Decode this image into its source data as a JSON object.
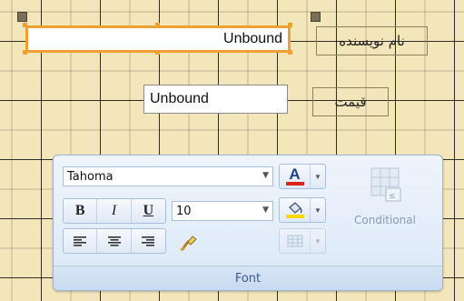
{
  "form": {
    "textbox_author": "Unbound",
    "label_author": "نام نویسنده",
    "textbox_price": "Unbound",
    "label_price": "قیمت"
  },
  "ribbon": {
    "font_name": "Tahoma",
    "font_size": "10",
    "bold": "B",
    "italic": "I",
    "underline": "U",
    "font_color_glyph": "A",
    "conditional_label": "Conditional",
    "group_label": "Font",
    "colors": {
      "font_color_bar": "#e0241c",
      "fill_bar": "#ffd800"
    }
  }
}
